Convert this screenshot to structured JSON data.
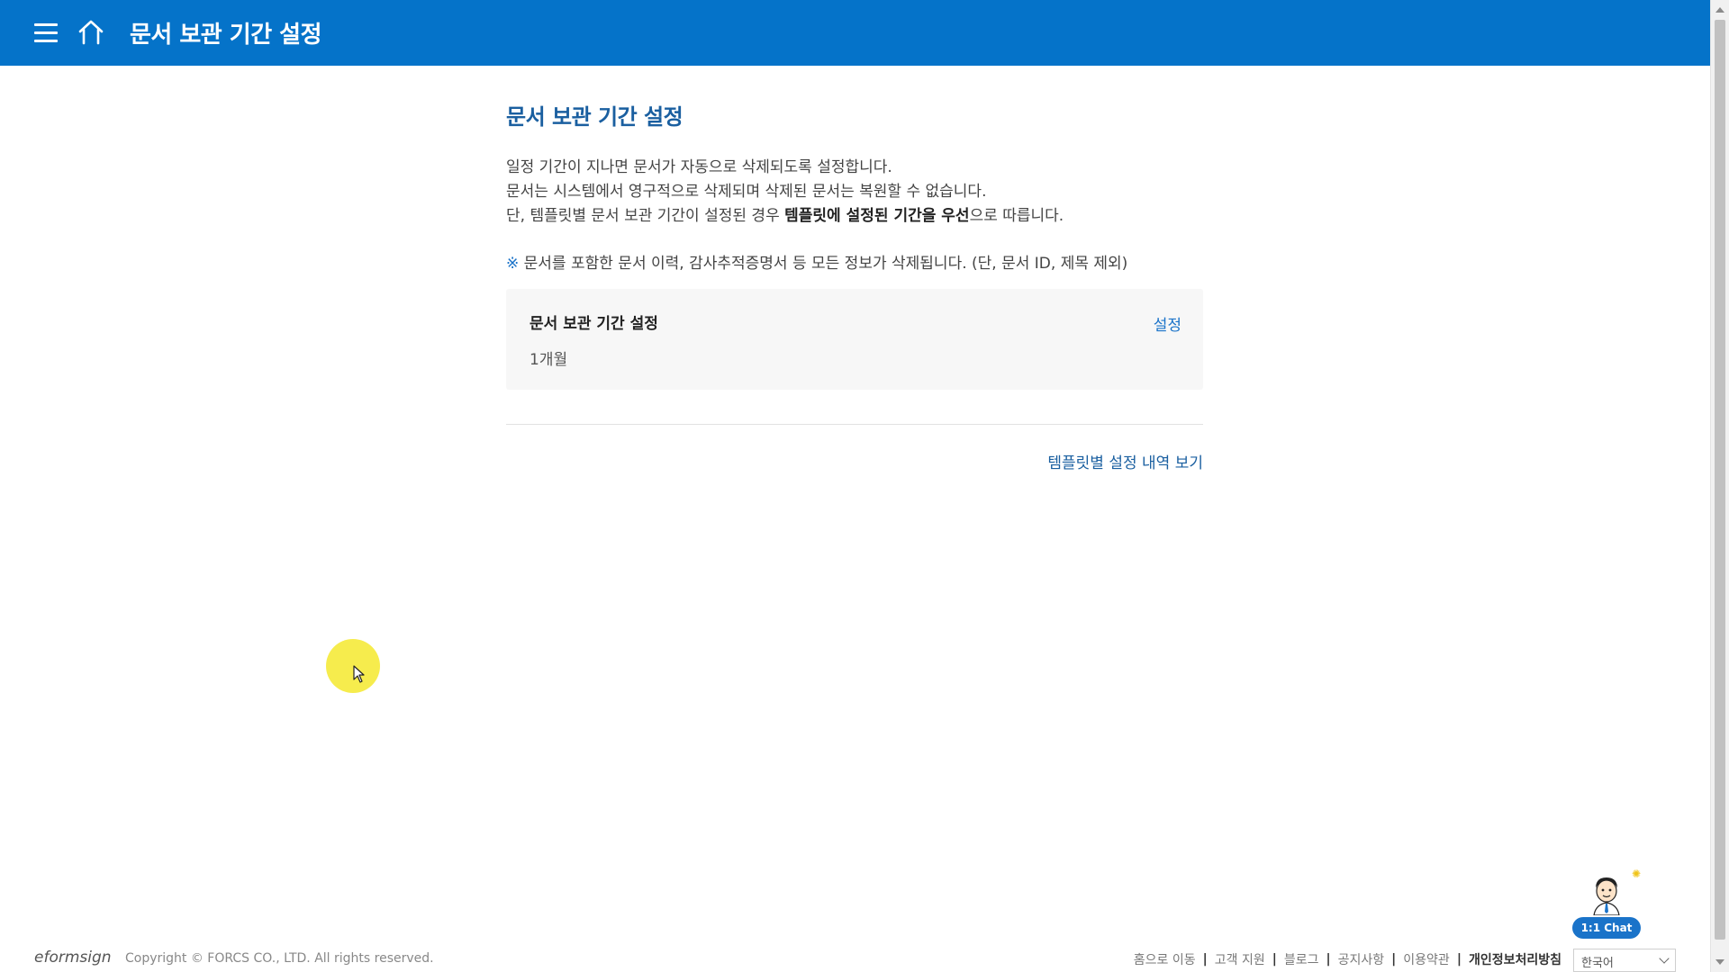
{
  "header": {
    "title": "문서 보관 기간 설정",
    "icons": {
      "menu": "hamburger-menu-icon",
      "home": "home-icon"
    }
  },
  "main": {
    "heading": "문서 보관 기간 설정",
    "description": {
      "line1": "일정 기간이 지나면 문서가 자동으로 삭제되도록 설정합니다.",
      "line2": "문서는 시스템에서 영구적으로 삭제되며 삭제된 문서는 복원할 수 없습니다.",
      "line3_prefix": "단, 템플릿별 문서 보관 기간이 설정된 경우 ",
      "line3_bold": "템플릿에 설정된 기간을 우선",
      "line3_suffix": "으로 따릅니다."
    },
    "notice": {
      "mark": "※",
      "text": " 문서를 포함한 문서 이력, 감사추적증명서 등 모든 정보가 삭제됩니다. (단, 문서 ID, 제목 제외)"
    },
    "retention_card": {
      "title": "문서 보관 기간 설정",
      "value": "1개월",
      "action_label": "설정"
    },
    "template_link": "템플릿별 설정 내역 보기"
  },
  "chat": {
    "label": "1:1 Chat",
    "icon": "chat-agent-avatar-icon"
  },
  "footer": {
    "logo": "eformsign",
    "copyright": "Copyright © FORCS CO., LTD. All rights reserved.",
    "links": [
      "홈으로 이동",
      "고객 지원",
      "블로그",
      "공지사항",
      "이용약관",
      "개인정보처리방침"
    ],
    "language": "한국어"
  },
  "colors": {
    "header_bg": "#0573c9",
    "accent": "#1a73c9",
    "heading": "#1a5fa0",
    "card_bg": "#f7f7f7"
  }
}
